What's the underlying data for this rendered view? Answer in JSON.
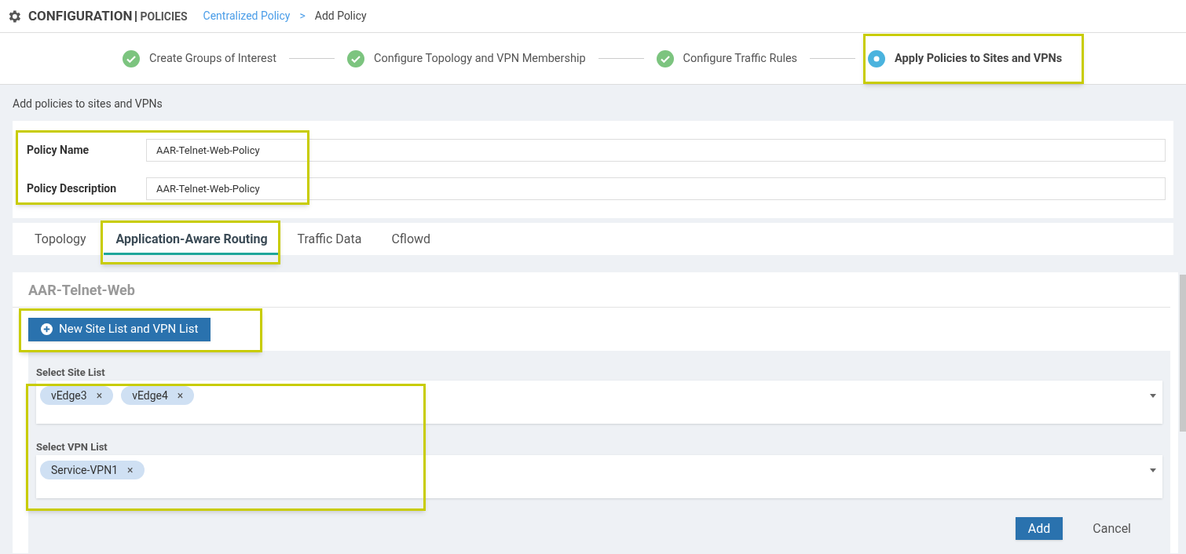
{
  "header": {
    "title": "CONFIGURATION",
    "section": "POLICIES",
    "breadcrumb": [
      {
        "label": "Centralized Policy",
        "link": true
      },
      {
        "label": "Add Policy",
        "link": false
      }
    ],
    "separator": ">"
  },
  "steps": [
    {
      "label": "Create Groups of Interest",
      "done": true
    },
    {
      "label": "Configure Topology and VPN Membership",
      "done": true
    },
    {
      "label": "Configure Traffic Rules",
      "done": true
    },
    {
      "label": "Apply Policies to Sites and VPNs",
      "done": false
    }
  ],
  "page_title": "Add policies to sites and VPNs",
  "policy_fields": [
    {
      "label": "Policy Name",
      "value": "AAR-Telnet-Web-Policy"
    },
    {
      "label": "Policy Description",
      "value": "AAR-Telnet-Web-Policy"
    }
  ],
  "tabs": [
    {
      "label": "Topology",
      "selected": false
    },
    {
      "label": "Application-Aware Routing",
      "selected": true
    },
    {
      "label": "Traffic Data",
      "selected": false
    },
    {
      "label": "Cflowd",
      "selected": false
    }
  ],
  "panel": {
    "title": "AAR-Telnet-Web",
    "new_button": "New Site List and VPN List",
    "selects": [
      {
        "label": "Select Site List",
        "tags": [
          "vEdge3",
          "vEdge4"
        ]
      },
      {
        "label": "Select VPN List",
        "tags": [
          "Service-VPN1"
        ]
      }
    ],
    "tag_remove": "×",
    "buttons": [
      {
        "label": "Add",
        "kind": "primary"
      },
      {
        "label": "Cancel",
        "kind": "plain"
      }
    ]
  }
}
